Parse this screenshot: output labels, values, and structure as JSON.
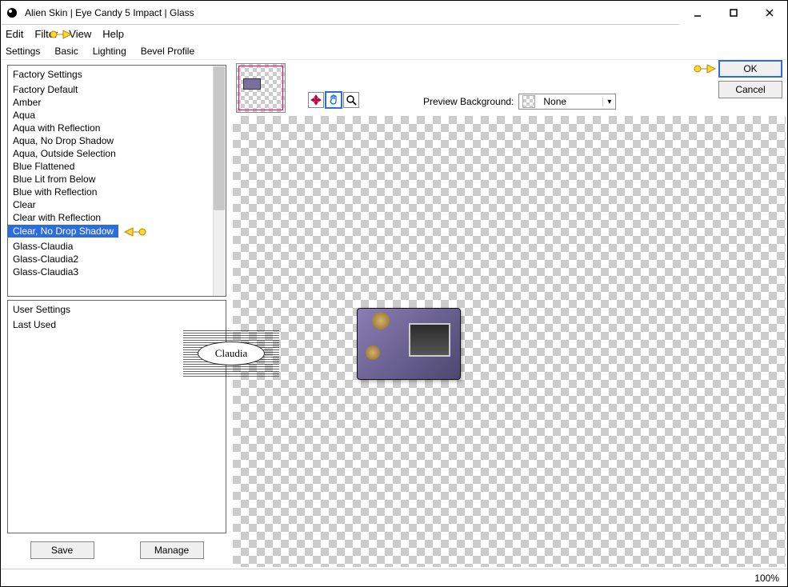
{
  "titlebar": {
    "title": "Alien Skin | Eye Candy 5 Impact | Glass"
  },
  "menu": {
    "edit": "Edit",
    "filter": "Filter",
    "view": "View",
    "help": "Help"
  },
  "tabs": {
    "settings": "Settings",
    "basic": "Basic",
    "lighting": "Lighting",
    "bevel": "Bevel Profile"
  },
  "factory": {
    "header": "Factory Settings",
    "items": [
      "Factory Default",
      "Amber",
      "Aqua",
      "Aqua with Reflection",
      "Aqua, No Drop Shadow",
      "Aqua, Outside Selection",
      "Blue Flattened",
      "Blue Lit from Below",
      "Blue with Reflection",
      "Clear",
      "Clear with Reflection",
      "Clear, No Drop Shadow",
      "Glass-Claudia",
      "Glass-Claudia2",
      "Glass-Claudia3"
    ],
    "selected_index": 11
  },
  "user": {
    "header": "User Settings",
    "items": [
      "Last Used"
    ]
  },
  "buttons": {
    "save": "Save",
    "manage": "Manage",
    "ok": "OK",
    "cancel": "Cancel"
  },
  "preview": {
    "bg_label": "Preview Background:",
    "bg_value": "None"
  },
  "status": {
    "zoom": "100%"
  },
  "watermark": {
    "text": "Claudia"
  }
}
